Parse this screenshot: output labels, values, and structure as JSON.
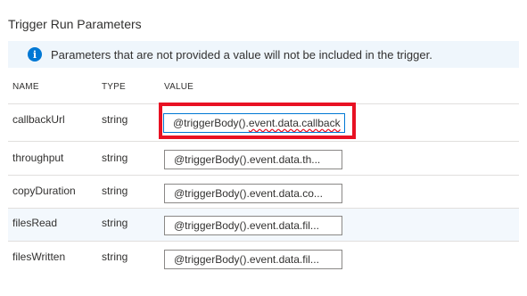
{
  "title": "Trigger Run Parameters",
  "info": {
    "icon": "info-icon",
    "text": "Parameters that are not provided a value will not be included in the trigger."
  },
  "columns": {
    "name": "NAME",
    "type": "TYPE",
    "value": "VALUE"
  },
  "rows": [
    {
      "name": "callbackUrl",
      "type": "string",
      "value_prefix": "@triggerBody().",
      "value_rest": "event.data.callback"
    },
    {
      "name": "throughput",
      "type": "string",
      "value": "@triggerBody().event.data.th..."
    },
    {
      "name": "copyDuration",
      "type": "string",
      "value": "@triggerBody().event.data.co..."
    },
    {
      "name": "filesRead",
      "type": "string",
      "value": "@triggerBody().event.data.fil..."
    },
    {
      "name": "filesWritten",
      "type": "string",
      "value": "@triggerBody().event.data.fil..."
    }
  ],
  "colors": {
    "accent": "#0078d4",
    "highlight_border": "#e81123",
    "info_background": "#eff6fc"
  }
}
